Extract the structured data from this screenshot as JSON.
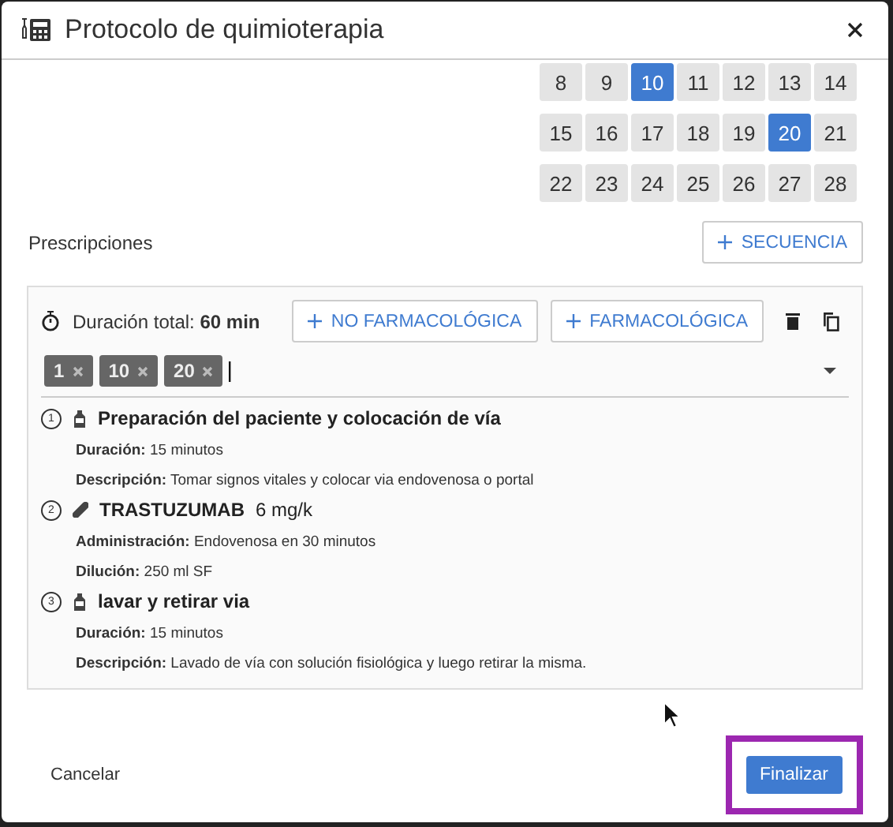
{
  "window": {
    "title": "Protocolo de quimioterapia"
  },
  "calendar": [
    [
      {
        "day": "8",
        "selected": false
      },
      {
        "day": "9",
        "selected": false
      },
      {
        "day": "10",
        "selected": true
      },
      {
        "day": "11",
        "selected": false
      },
      {
        "day": "12",
        "selected": false
      },
      {
        "day": "13",
        "selected": false
      },
      {
        "day": "14",
        "selected": false
      }
    ],
    [
      {
        "day": "15",
        "selected": false
      },
      {
        "day": "16",
        "selected": false
      },
      {
        "day": "17",
        "selected": false
      },
      {
        "day": "18",
        "selected": false
      },
      {
        "day": "19",
        "selected": false
      },
      {
        "day": "20",
        "selected": true
      },
      {
        "day": "21",
        "selected": false
      }
    ],
    [
      {
        "day": "22",
        "selected": false
      },
      {
        "day": "23",
        "selected": false
      },
      {
        "day": "24",
        "selected": false
      },
      {
        "day": "25",
        "selected": false
      },
      {
        "day": "26",
        "selected": false
      },
      {
        "day": "27",
        "selected": false
      },
      {
        "day": "28",
        "selected": false
      }
    ]
  ],
  "prescriptions": {
    "label": "Prescripciones",
    "add_button": "SECUENCIA"
  },
  "sequence": {
    "duration": "Duración total: **60 min**",
    "buttons": [
      "NO FARMACOLÓGICA",
      "FARMACOLÓGICA"
    ],
    "tags": [
      "1",
      "10",
      "20"
    ],
    "items": [
      {
        "number": "1",
        "kind": "procedure",
        "title": "Preparación del paciente y colocación de vía",
        "details": [
          "**Duración:** 15 minutos",
          "**Descripción:** Tomar signos vitales y colocar via endovenosa o portal"
        ]
      },
      {
        "number": "2",
        "kind": "drug",
        "title": "TRASTUZUMAB",
        "dose": "6 mg/k",
        "details": [
          "**Administración:** Endovenosa en 30 minutos",
          "**Dilución:** 250 ml SF"
        ]
      },
      {
        "number": "3",
        "kind": "procedure",
        "title": "lavar y retirar via",
        "details": [
          "**Duración:** 15 minutos",
          "**Descripción:** Lavado de vía con solución fisiológica y luego retirar la misma."
        ]
      }
    ]
  },
  "footer": {
    "cancel": "Cancelar",
    "finish": "Finalizar",
    "finish_highlighted": true
  }
}
